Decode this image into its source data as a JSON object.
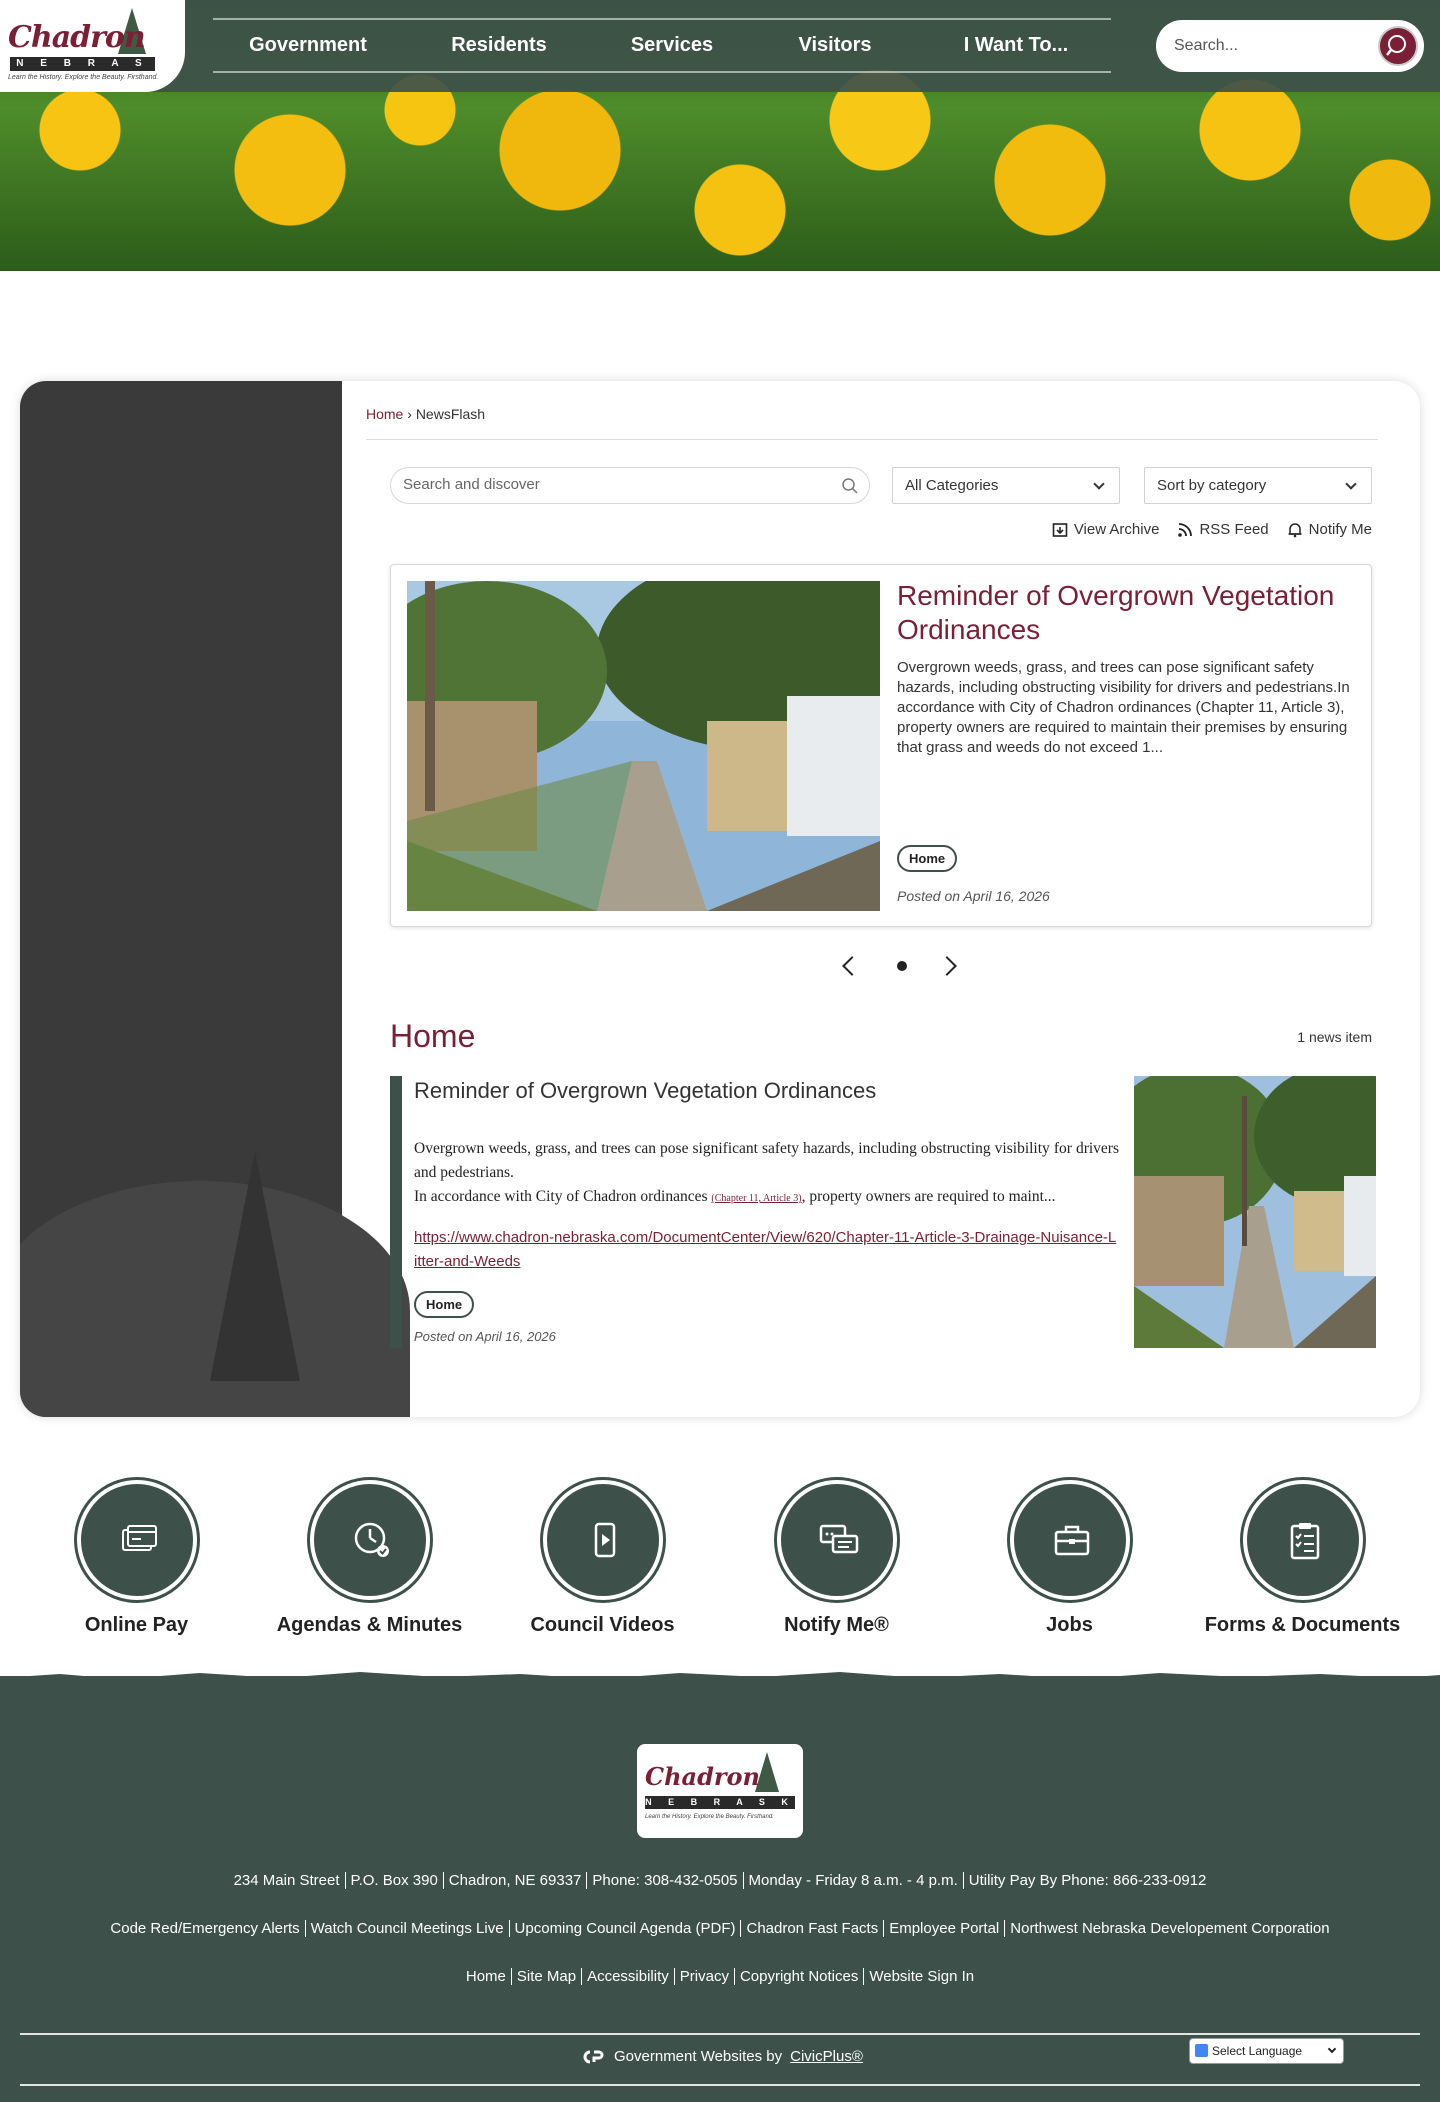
{
  "header": {
    "logo": {
      "word": "Chadron",
      "state": "N E B R A S K A",
      "tagline": "Learn the History. Explore the Beauty. Firsthand."
    },
    "nav": [
      "Government",
      "Residents",
      "Services",
      "Visitors",
      "I Want To..."
    ],
    "search_placeholder": "Search..."
  },
  "breadcrumb": {
    "home": "Home",
    "separator": "›",
    "current": "NewsFlash"
  },
  "filters": {
    "search_placeholder": "Search and discover",
    "category": "All Categories",
    "sort": "Sort by category"
  },
  "utilities": {
    "archive": "View Archive",
    "rss": "RSS Feed",
    "notify": "Notify Me"
  },
  "feature": {
    "title": "Reminder of Overgrown Vegetation Ordinances",
    "description": "Overgrown weeds, grass, and trees can pose significant safety hazards, including obstructing visibility for drivers and pedestrians.In accordance with City of Chadron ordinances (Chapter 11, Article 3), property owners are required to maintain their premises by ensuring that grass and weeds do not exceed 1...",
    "tag": "Home",
    "posted": "Posted on April 16, 2026"
  },
  "section": {
    "title": "Home",
    "count": "1 news item",
    "item": {
      "title": "Reminder of Overgrown Vegetation Ordinances",
      "body_line1": "Overgrown weeds, grass, and trees can pose significant safety hazards, including obstructing visibility for drivers and pedestrians.",
      "body_line2_a": "In accordance with City of Chadron ordinances ",
      "body_ref": "(Chapter 11, Article 3)",
      "body_line2_b": ", property owners are required to maint...",
      "link": "https://www.chadron-nebraska.com/DocumentCenter/View/620/Chapter-11-Article-3-Drainage-Nuisance-Litter-and-Weeds",
      "tag": "Home",
      "posted": "Posted on April 16, 2026"
    }
  },
  "quick_links": [
    {
      "label": "Online Pay",
      "icon": "payment-icon"
    },
    {
      "label": "Agendas & Minutes",
      "icon": "clock-icon"
    },
    {
      "label": "Council Videos",
      "icon": "video-icon"
    },
    {
      "label": "Notify Me®",
      "icon": "chat-icon"
    },
    {
      "label": "Jobs",
      "icon": "briefcase-icon"
    },
    {
      "label": "Forms & Documents",
      "icon": "clipboard-icon"
    }
  ],
  "footer": {
    "contact": [
      "234 Main Street",
      "P.O. Box 390",
      "Chadron, NE 69337",
      "Phone: 308-432-0505",
      "Monday - Friday 8 a.m. - 4 p.m.",
      "Utility Pay By Phone: 866-233-0912"
    ],
    "links1": [
      "Code Red/Emergency Alerts",
      "Watch Council Meetings Live",
      "Upcoming Council Agenda (PDF)",
      "Chadron Fast Facts",
      "Employee Portal",
      "Northwest Nebraska Developement Corporation"
    ],
    "links2": [
      "Home",
      "Site Map",
      "Accessibility",
      "Privacy",
      "Copyright Notices",
      "Website Sign In"
    ],
    "credit_prefix": "Government Websites by",
    "credit_link": "CivicPlus®",
    "language": "Select Language"
  },
  "colors": {
    "brand": "#7a1f35",
    "green": "#3e504a",
    "sidebar": "#3a3a3a"
  }
}
